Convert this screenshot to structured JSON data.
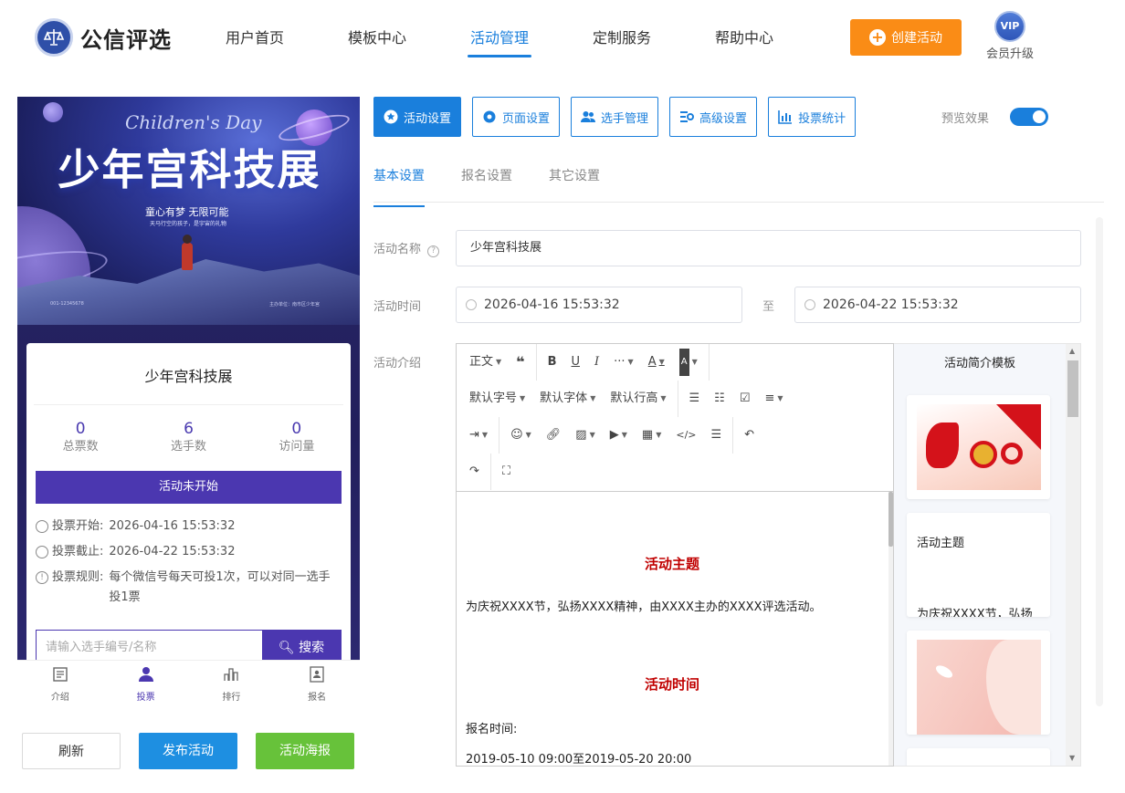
{
  "header": {
    "brand": "公信评选",
    "nav": [
      "用户首页",
      "模板中心",
      "活动管理",
      "定制服务",
      "帮助中心"
    ],
    "create_label": "创建活动",
    "vip_badge": "VIP",
    "vip_label": "会员升级"
  },
  "preview": {
    "banner_script": "Children's Day",
    "banner_title": "少年宫科技展",
    "banner_sub": "童心有梦 无限可能",
    "banner_sub2": "天马行空的孩子，是宇宙的礼物",
    "banner_foot_left": "001-12345678",
    "banner_foot_right": "主办单位：南市区少年宫",
    "card_title": "少年宫科技展",
    "stats": [
      {
        "num": "0",
        "label": "总票数"
      },
      {
        "num": "6",
        "label": "选手数"
      },
      {
        "num": "0",
        "label": "访问量"
      }
    ],
    "status": "活动未开始",
    "vote_start_key": "投票开始:",
    "vote_start_val": "2026-04-16 15:53:32",
    "vote_end_key": "投票截止:",
    "vote_end_val": "2026-04-22 15:53:32",
    "rule_key": "投票规则:",
    "rule_val": "每个微信号每天可投1次，可以对同一选手投1票",
    "search_placeholder": "请输入选手编号/名称",
    "search_btn": "搜索",
    "tabs": [
      "介绍",
      "投票",
      "排行",
      "报名"
    ]
  },
  "bottom_buttons": {
    "refresh": "刷新",
    "publish": "发布活动",
    "poster": "活动海报"
  },
  "toolbar": {
    "buttons": [
      "活动设置",
      "页面设置",
      "选手管理",
      "高级设置",
      "投票统计"
    ],
    "preview_label": "预览效果"
  },
  "subtabs": [
    "基本设置",
    "报名设置",
    "其它设置"
  ],
  "form": {
    "name_label": "活动名称",
    "name_value": "少年宫科技展",
    "time_label": "活动时间",
    "start_time": "2026-04-16 15:53:32",
    "separator": "至",
    "end_time": "2026-04-22 15:53:32",
    "intro_label": "活动介绍"
  },
  "editor": {
    "row1": [
      "正文",
      "❝",
      "B",
      "U",
      "I",
      "···",
      "A",
      "A"
    ],
    "row2": [
      "默认字号",
      "默认字体",
      "默认行高"
    ],
    "heading1": "活动主题",
    "para1": "为庆祝XXXX节，弘扬XXXX精神，由XXXX主办的XXXX评选活动。",
    "heading2": "活动时间",
    "para2": "报名时间:",
    "para3": "2019-05-10 09:00至2019-05-20 20:00"
  },
  "templates": {
    "title": "活动简介模板",
    "card2_title": "活动主题",
    "card2_text": "为庆祝XXXX节，弘扬"
  },
  "colors": {
    "primary": "#1a7fdc",
    "orange": "#fa8c16",
    "purple": "#4b37b0",
    "green": "#67c23a",
    "red_heading": "#c00000"
  }
}
